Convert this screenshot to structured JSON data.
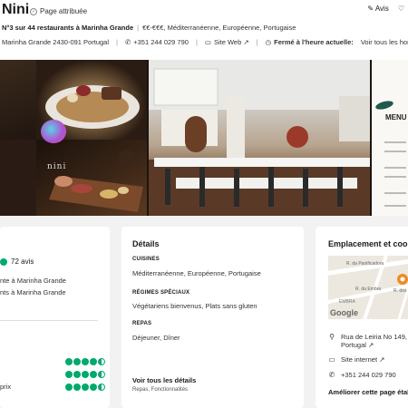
{
  "header": {
    "title": "Nini",
    "attributed": "Page attribuée",
    "review_label": "Avis",
    "ranking": "N°3 sur 44 restaurants à Marinha Grande",
    "price_cuisine": "€€-€€€, Méditerranéenne, Européenne, Portugaise",
    "address": "Marinha Grande 2430-091 Portugal",
    "phone": "+351 244 029 790",
    "website": "Site Web ↗",
    "hours_status": "Fermé à l'heure actuelle:",
    "hours_link": "Voir tous les horaires",
    "logo_text": "nini",
    "menu_label": "MENU"
  },
  "ratings": {
    "count": "72 avis",
    "rank_line1": "nte à Marinha Grande",
    "rank_line2": "nts à Marinha Grande",
    "sub_label": "prix"
  },
  "details": {
    "heading": "Détails",
    "cuisines_label": "CUISINES",
    "cuisines": "Méditerranéenne, Européenne, Portugaise",
    "diets_label": "RÉGIMES SPÉCIAUX",
    "diets": "Végétariens bienvenus, Plats sans gluten",
    "meals_label": "REPAS",
    "meals": "Déjeuner, Dîner",
    "see_all": "Voir tous les détails",
    "see_all_sub": "Repas, Fonctionnalités"
  },
  "location": {
    "heading": "Emplacement et coordo",
    "map_street1": "R. da Panificadora",
    "map_street2": "R. da Embra",
    "map_area": "EMBRA",
    "map_street3": "R. dos",
    "map_logo": "Google",
    "address_line1": "Rua de Leiria No 149, Ma",
    "address_line2": "Portugal ↗",
    "website": "Site internet ↗",
    "phone": "+351 244 029 790",
    "improve": "Améliorer cette page établi"
  },
  "colors": {
    "accent_green": "#00aa6c"
  }
}
